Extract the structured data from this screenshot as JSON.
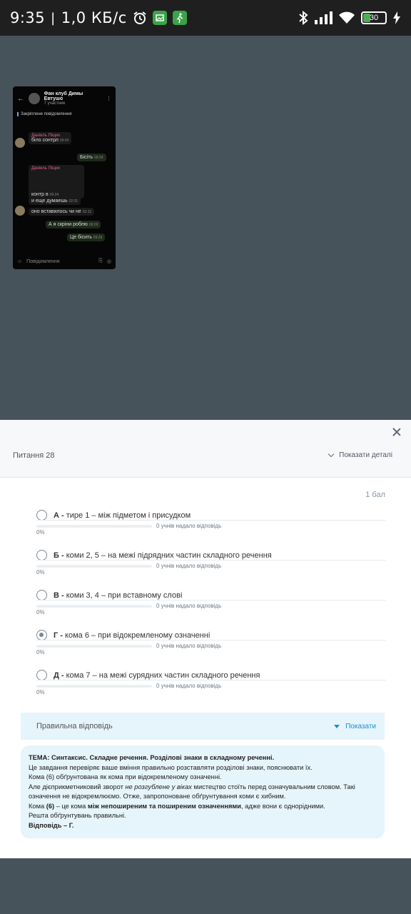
{
  "status_bar": {
    "time": "9:35",
    "speed": "1,0 КБ/с",
    "battery": "30"
  },
  "background_chat": {
    "title": "Фан клуб Димы Евтушо",
    "subtitle": "7 участник",
    "pinned": "Закріплене повідомлення",
    "messages": [
      {
        "name": "Даніель Піщик",
        "text": "біло сонтрл",
        "time": "09:24"
      },
      {
        "text": "Бісіть",
        "time": "09:24"
      },
      {
        "name": "Даніель Піщик",
        "text": "контр в",
        "time": "09:24"
      },
      {
        "text": "и еще думаешь",
        "time": "02:31"
      },
      {
        "text": "оно вставилось чи не",
        "time": "02:31"
      },
      {
        "text": "А я скріни роблю",
        "time": "09:29"
      },
      {
        "text": "Це бісить",
        "time": "09:29"
      }
    ],
    "input_placeholder": "Повідомлення"
  },
  "sheet": {
    "question_title": "Питання 28",
    "details_label": "Показати деталі",
    "points": "1 бал",
    "options": [
      {
        "letter": "А -",
        "text": "тире 1 – між підметом і присудком",
        "answered": "0 учнів надало відповідь",
        "percent": "0%",
        "selected": false
      },
      {
        "letter": "Б -",
        "text": "коми 2, 5 – на межі підрядних частин складного речення",
        "answered": "0 учнів надало відповідь",
        "percent": "0%",
        "selected": false
      },
      {
        "letter": "В -",
        "text": "коми 3, 4 – при вставному слові",
        "answered": "0 учнів надало відповідь",
        "percent": "0%",
        "selected": false
      },
      {
        "letter": "Г -",
        "text": "кома 6 – при відокремленому означенні",
        "answered": "0 учнів надало відповідь",
        "percent": "0%",
        "selected": true
      },
      {
        "letter": "Д -",
        "text": "кома 7 – на межі сурядних частин складного речення",
        "answered": "0 учнів надало відповідь",
        "percent": "0%",
        "selected": false
      }
    ],
    "correct_answer_label": "Правильна відповідь",
    "show_label": "Показати",
    "explanation": {
      "line1": "ТЕМА: Синтаксис. Складне речення. Розділові знаки в складному реченні.",
      "line2": "Це завдання перевіряє ваше вміння правильно розставляти розділові знаки, пояснювати їх.",
      "line3": "Кома (6) обґрунтована як кома при відокремленому означенні.",
      "line4a": "Але дієприкметниковий зворот ",
      "line4b": "не розгублене у віках",
      "line4c": " мистецтво стоїть перед означувальним словом. Такі",
      "line5": "означення не відокремлюємо. Отже, запропоноване обґрунтування коми є хибним.",
      "line6a": "Кома ",
      "line6b": "(6)",
      "line6c": " – це кома ",
      "line6d": "між непоширеним та поширеним означеннями",
      "line6e": ", адже вони є однорідними.",
      "line7": "Решта обґрунтувань правильні.",
      "line8": "Відповідь – Г."
    }
  }
}
